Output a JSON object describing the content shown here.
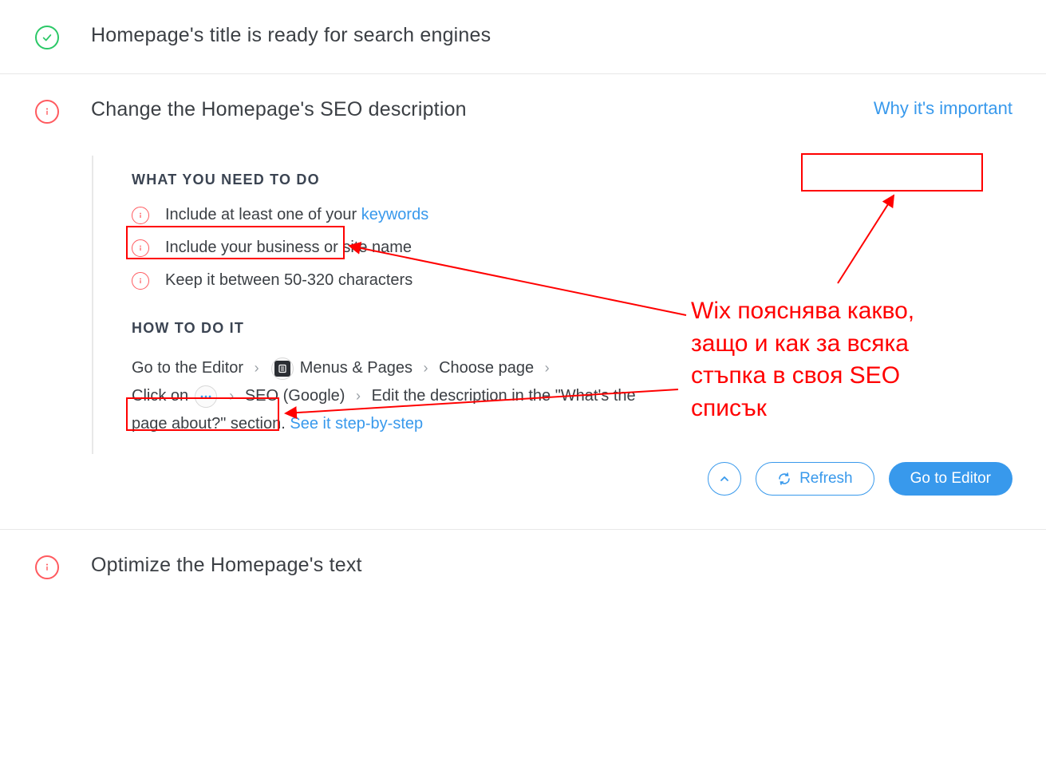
{
  "items": {
    "title_ready": "Homepage's title is ready for search engines",
    "seo_desc": {
      "title": "Change the Homepage's SEO description",
      "why": "Why it's important",
      "what_heading": "WHAT YOU NEED TO DO",
      "checks": {
        "c1_pre": "Include at least one of your ",
        "c1_link": "keywords",
        "c2": "Include your business or site name",
        "c3": "Keep it between 50-320 characters"
      },
      "how_heading": "HOW TO DO IT",
      "instr": {
        "go_editor": "Go to the Editor",
        "menus_pages": "Menus & Pages",
        "choose_page": "Choose page",
        "click_on": "Click on",
        "seo_google": "SEO (Google)",
        "edit_desc": "Edit the description in the \"What's the page about?\" section.",
        "see_it": "See it step-by-step"
      }
    },
    "optimize_text": "Optimize the Homepage's text"
  },
  "actions": {
    "refresh": "Refresh",
    "go_editor": "Go to Editor"
  },
  "annotation": {
    "text": "Wix пояснява какво, защо и как за всяка стъпка в своя SEO списък"
  }
}
